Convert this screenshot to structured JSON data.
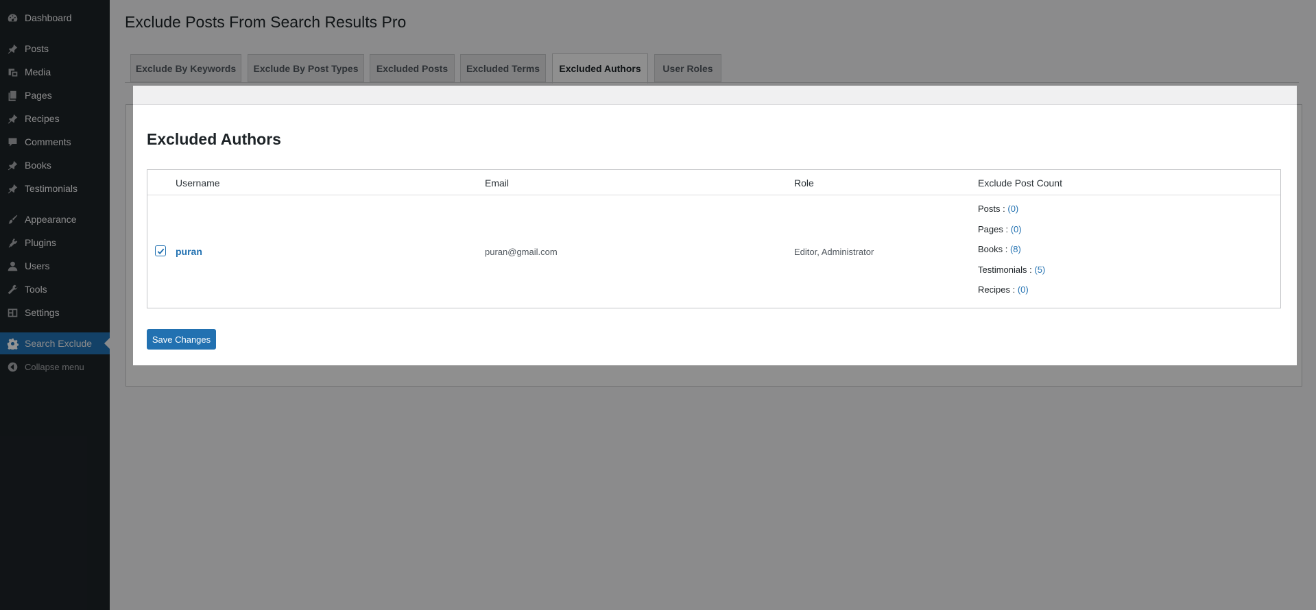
{
  "sidebar": {
    "items": [
      {
        "label": "Dashboard",
        "icon": "dashboard-icon"
      },
      {
        "label": "Posts",
        "icon": "pin-icon"
      },
      {
        "label": "Media",
        "icon": "media-icon"
      },
      {
        "label": "Pages",
        "icon": "pages-icon"
      },
      {
        "label": "Recipes",
        "icon": "pin-icon"
      },
      {
        "label": "Comments",
        "icon": "comment-icon"
      },
      {
        "label": "Books",
        "icon": "pin-icon"
      },
      {
        "label": "Testimonials",
        "icon": "pin-icon"
      },
      {
        "label": "Appearance",
        "icon": "brush-icon"
      },
      {
        "label": "Plugins",
        "icon": "plugin-icon"
      },
      {
        "label": "Users",
        "icon": "user-icon"
      },
      {
        "label": "Tools",
        "icon": "wrench-icon"
      },
      {
        "label": "Settings",
        "icon": "settings-icon"
      },
      {
        "label": "Search Exclude",
        "icon": "gear-icon"
      },
      {
        "label": "Collapse menu",
        "icon": "collapse-icon"
      }
    ]
  },
  "page": {
    "title": "Exclude Posts From Search Results Pro"
  },
  "tabs": [
    {
      "label": "Exclude By Keywords"
    },
    {
      "label": "Exclude By Post Types"
    },
    {
      "label": "Excluded Posts"
    },
    {
      "label": "Excluded Terms"
    },
    {
      "label": "Excluded Authors"
    },
    {
      "label": "User Roles"
    }
  ],
  "section": {
    "title": "Excluded Authors"
  },
  "table": {
    "headers": [
      "Username",
      "Email",
      "Role",
      "Exclude Post Count"
    ],
    "rows": [
      {
        "checked": true,
        "username": "puran",
        "email": "puran@gmail.com",
        "role": "Editor, Administrator",
        "counts": [
          {
            "label": "Posts : ",
            "value": "(0)"
          },
          {
            "label": "Pages : ",
            "value": "(0)"
          },
          {
            "label": "Books : ",
            "value": "(8)"
          },
          {
            "label": "Testimonials : ",
            "value": "(5)"
          },
          {
            "label": "Recipes : ",
            "value": "(0)"
          }
        ]
      }
    ]
  },
  "actions": {
    "save_label": "Save Changes"
  },
  "colors": {
    "accent": "#2271b1",
    "sidebar_bg": "#1d2327"
  }
}
